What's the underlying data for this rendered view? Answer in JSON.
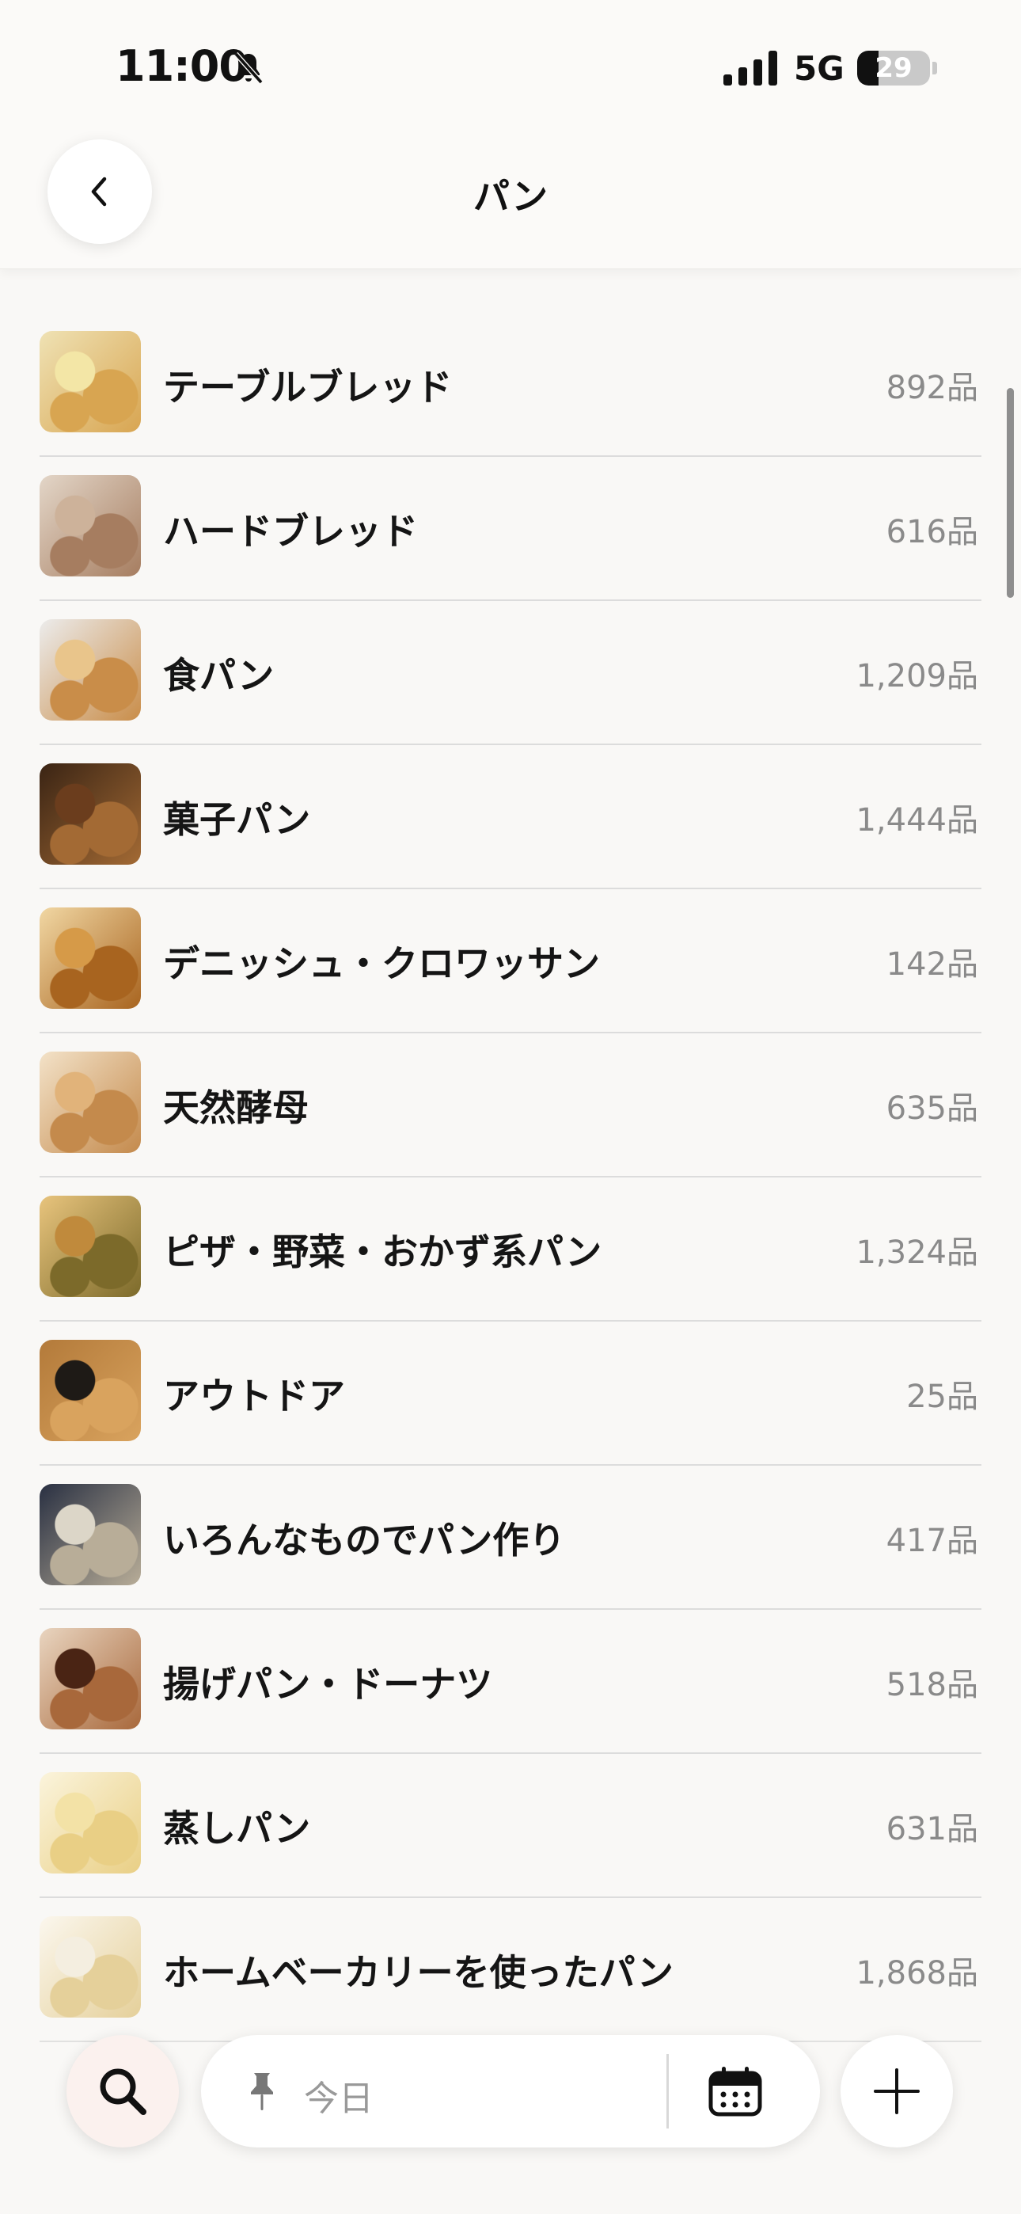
{
  "status_bar": {
    "time": "11:00",
    "network": "5G",
    "battery": "29",
    "battery_level": 0.29
  },
  "header": {
    "title": "パン"
  },
  "categories": [
    {
      "label": "テーブルブレッド",
      "count": "892品",
      "thumb_colors": [
        "#f3e6a6",
        "#d8a551",
        "#efe2b4"
      ]
    },
    {
      "label": "ハードブレッド",
      "count": "616品",
      "thumb_colors": [
        "#cdb29a",
        "#a67d60",
        "#e3d6c8"
      ]
    },
    {
      "label": "食パン",
      "count": "1,209品",
      "thumb_colors": [
        "#e9c58b",
        "#c98d49",
        "#ececec"
      ]
    },
    {
      "label": "菓子パン",
      "count": "1,444品",
      "thumb_colors": [
        "#6b3d1d",
        "#a36a34",
        "#3a2414"
      ]
    },
    {
      "label": "デニッシュ・クロワッサン",
      "count": "142品",
      "thumb_colors": [
        "#d69a48",
        "#a8641f",
        "#f1d7a3"
      ]
    },
    {
      "label": "天然酵母",
      "count": "635品",
      "thumb_colors": [
        "#e1b37a",
        "#c48a4c",
        "#f3e2c8"
      ]
    },
    {
      "label": "ピザ・野菜・おかず系パン",
      "count": "1,324品",
      "thumb_colors": [
        "#c08a3c",
        "#7c6a2a",
        "#e8c47d"
      ]
    },
    {
      "label": "アウトドア",
      "count": "25品",
      "thumb_colors": [
        "#1e1a16",
        "#d9a35e",
        "#b37a3a"
      ]
    },
    {
      "label": "いろんなものでパン作り",
      "count": "417品",
      "thumb_colors": [
        "#dcd6c8",
        "#b8ad98",
        "#293042"
      ]
    },
    {
      "label": "揚げパン・ドーナツ",
      "count": "518品",
      "thumb_colors": [
        "#4a2414",
        "#a8683b",
        "#e9d5c0"
      ]
    },
    {
      "label": "蒸しパン",
      "count": "631品",
      "thumb_colors": [
        "#f3e2a6",
        "#e9cf85",
        "#fbf4dc"
      ]
    },
    {
      "label": "ホームベーカリーを使ったパン",
      "count": "1,868品",
      "thumb_colors": [
        "#f4eee0",
        "#e5d09a",
        "#fbf7ee"
      ]
    }
  ],
  "bottom_bar": {
    "date_label": "今日"
  },
  "icons": {
    "back": "chevron-left-icon",
    "search": "search-icon",
    "pin": "pin-icon",
    "calendar": "calendar-icon",
    "add": "plus-icon",
    "bell_muted": "bell-slash-icon",
    "signal": "signal-icon",
    "battery": "battery-icon"
  },
  "colors": {
    "background": "#f9f8f6",
    "count_text": "#8a8a8a",
    "search_button_bg": "#fbf1ee"
  }
}
